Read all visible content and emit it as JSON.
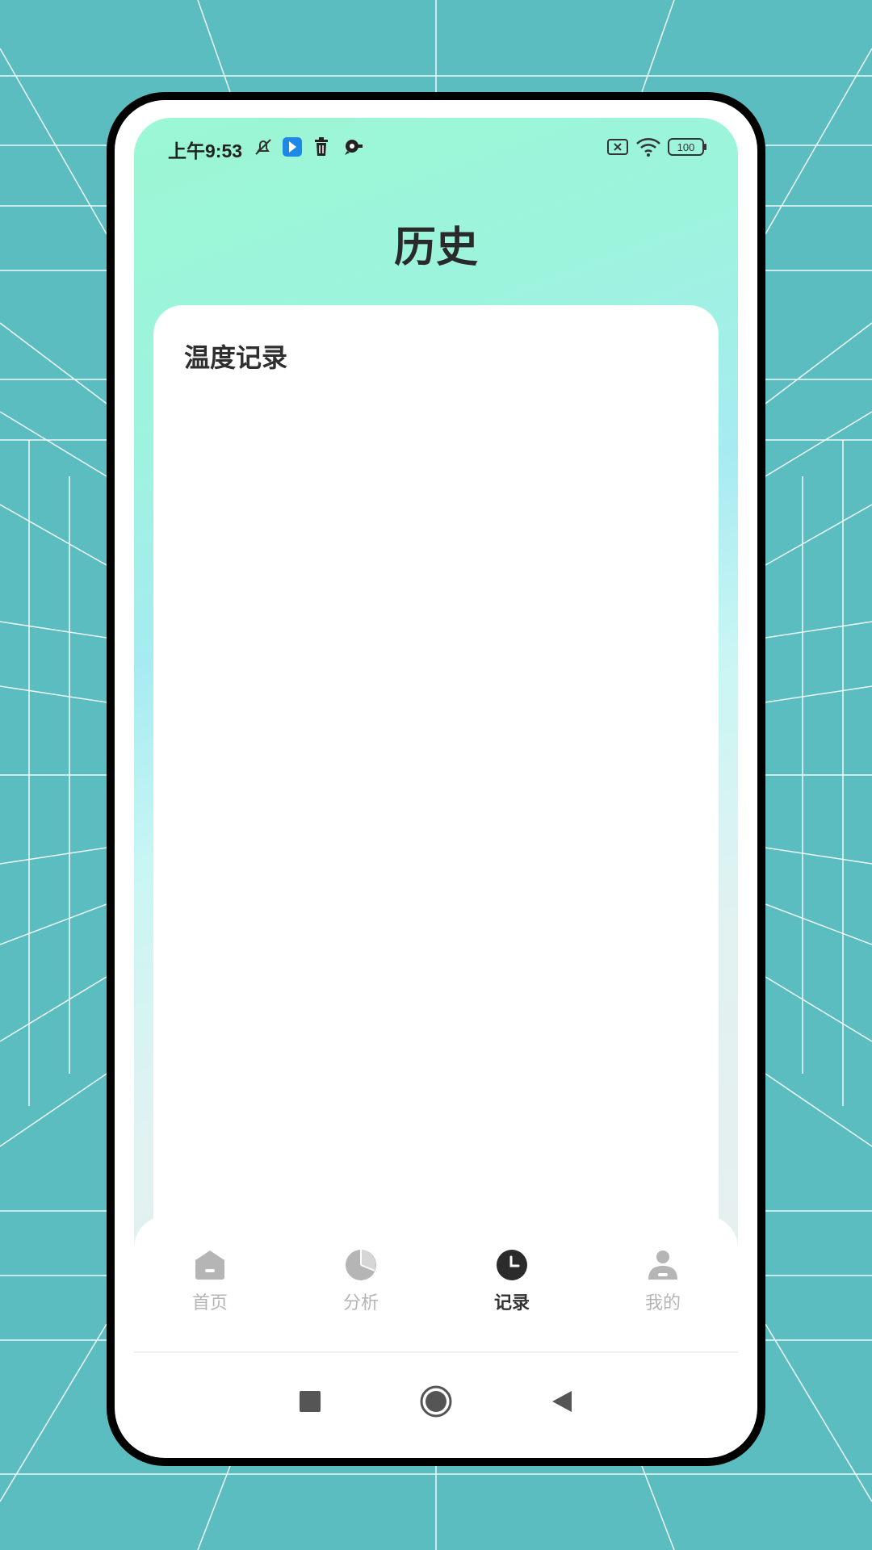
{
  "status_bar": {
    "time": "上午9:53",
    "battery": "100"
  },
  "header": {
    "title": "历史"
  },
  "card": {
    "heading": "温度记录"
  },
  "bottom_nav": {
    "items": [
      {
        "label": "首页",
        "icon": "home-icon",
        "active": false
      },
      {
        "label": "分析",
        "icon": "pie-chart-icon",
        "active": false
      },
      {
        "label": "记录",
        "icon": "clock-icon",
        "active": true
      },
      {
        "label": "我的",
        "icon": "user-icon",
        "active": false
      }
    ]
  },
  "system_nav": {
    "buttons": [
      "recent-apps-icon",
      "home-circle-icon",
      "back-icon"
    ]
  },
  "colors": {
    "background": "#5bbdbf",
    "gradient_top": "#9bf7d4",
    "nav_active": "#333333",
    "nav_inactive": "#b5b5b5"
  }
}
